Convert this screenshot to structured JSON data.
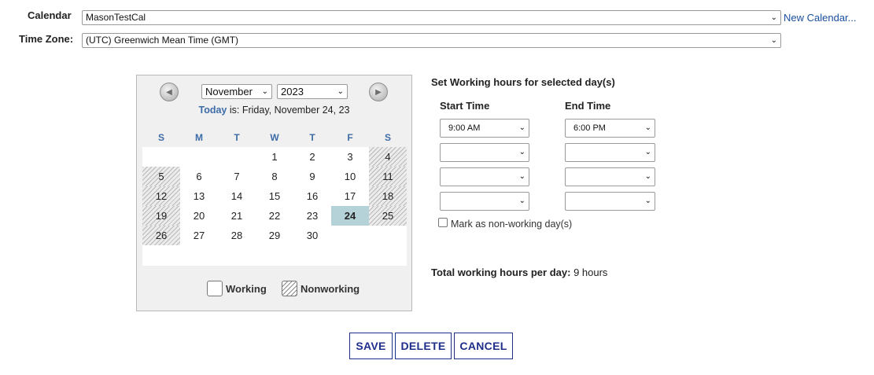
{
  "header": {
    "calendar_label": "Calendar",
    "calendar_value": "MasonTestCal",
    "new_calendar_link": "New Calendar...",
    "timezone_label": "Time Zone:",
    "timezone_value": "(UTC) Greenwich Mean Time (GMT)"
  },
  "calendar": {
    "month": "November",
    "year": "2023",
    "today_word": "Today",
    "today_rest": " is: Friday, November 24, 23",
    "day_headers": [
      "S",
      "M",
      "T",
      "W",
      "T",
      "F",
      "S"
    ],
    "weeks": [
      [
        "",
        "",
        "",
        "1",
        "2",
        "3",
        "4"
      ],
      [
        "5",
        "6",
        "7",
        "8",
        "9",
        "10",
        "11"
      ],
      [
        "12",
        "13",
        "14",
        "15",
        "16",
        "17",
        "18"
      ],
      [
        "19",
        "20",
        "21",
        "22",
        "23",
        "24",
        "25"
      ],
      [
        "26",
        "27",
        "28",
        "29",
        "30",
        "",
        ""
      ]
    ],
    "today": "24",
    "legend_working": "Working",
    "legend_nonworking": "Nonworking"
  },
  "hours": {
    "title": "Set Working hours for selected day(s)",
    "start_header": "Start Time",
    "end_header": "End Time",
    "rows": [
      {
        "start": "9:00 AM",
        "end": "6:00 PM"
      },
      {
        "start": "",
        "end": ""
      },
      {
        "start": "",
        "end": ""
      },
      {
        "start": "",
        "end": ""
      }
    ],
    "nonworking_label": "Mark as non-working day(s)",
    "total_label": "Total working hours per day:",
    "total_value": " 9 hours"
  },
  "actions": {
    "save": "SAVE",
    "delete": "DELETE",
    "cancel": "CANCEL"
  },
  "colors": {
    "link": "#1a4fa0",
    "today_highlight": "#b6d2d9",
    "button_border": "#1d2f8a"
  }
}
